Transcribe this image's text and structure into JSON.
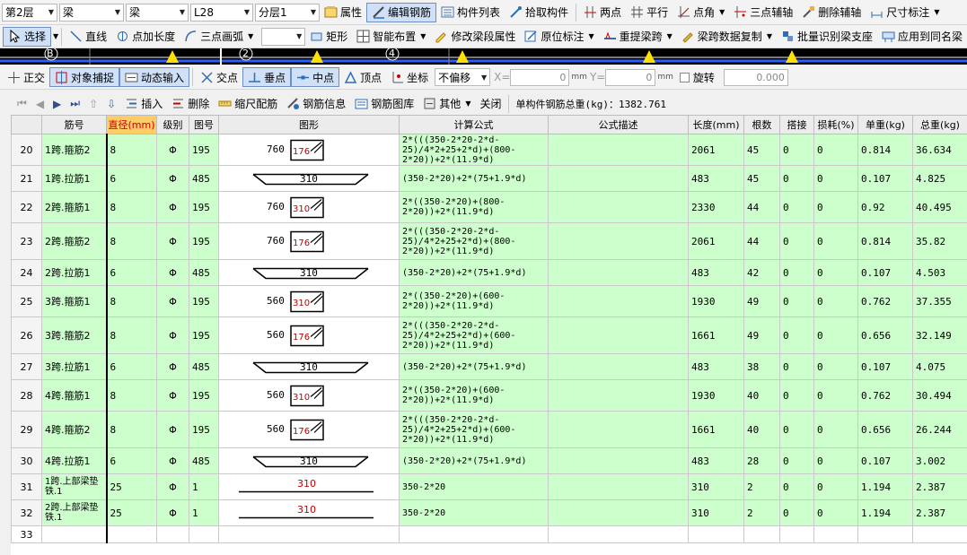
{
  "toolbar1": {
    "floor": "第2层",
    "type1": "梁",
    "type2": "梁",
    "element": "L28",
    "sublayer": "分层1",
    "attr": "属性",
    "edit_rebar": "编辑钢筋",
    "member_list": "构件列表",
    "pick_member": "拾取构件",
    "two_point": "两点",
    "parallel": "平行",
    "point_angle": "点角",
    "three_point_axis": "三点辅轴",
    "delete_axis": "删除辅轴",
    "dimension": "尺寸标注"
  },
  "toolbar2": {
    "select": "选择",
    "line": "直线",
    "point_length": "点加长度",
    "three_point_arc": "三点画弧",
    "rect": "矩形",
    "smart_layout": "智能布置",
    "modify_span": "修改梁段属性",
    "original_mark": "原位标注",
    "re_extract_span": "重提梁跨",
    "copy_span_data": "梁跨数据复制",
    "batch_support": "批量识别梁支座",
    "apply_same": "应用到同名梁"
  },
  "canvas": {
    "labels": [
      "B",
      "2",
      "4"
    ]
  },
  "toolbar3": {
    "ortho": "正交",
    "snap": "对象捕捉",
    "dynamic_input": "动态输入",
    "intersection": "交点",
    "perpendicular": "垂点",
    "midpoint": "中点",
    "vertex": "顶点",
    "coordinate": "坐标",
    "offset_mode": "不偏移",
    "x_label": "X=",
    "x_value": "0",
    "y_label": "Y=",
    "y_value": "0",
    "unit": "mm",
    "rotate_label": "旋转",
    "rotate_value": "0.000"
  },
  "toolbar4": {
    "insert": "插入",
    "delete": "删除",
    "scale_rebar": "缩尺配筋",
    "rebar_info": "钢筋信息",
    "rebar_library": "钢筋图库",
    "other": "其他",
    "close": "关闭",
    "total_label": "单构件钢筋总重(kg)：1382.761"
  },
  "table": {
    "headers": [
      "筋号",
      "直径(mm)",
      "级别",
      "图号",
      "图形",
      "计算公式",
      "公式描述",
      "长度(mm)",
      "根数",
      "搭接",
      "损耗(%)",
      "单重(kg)",
      "总重(kg)"
    ],
    "rows": [
      {
        "num": "20",
        "name": "1跨.箍筋2",
        "dia": "8",
        "grade": "Φ",
        "fig": "195",
        "shape": "stirrup",
        "s1": "760",
        "s2": "176",
        "formula": "2*(((350-2*20-2*d-25)/4*2+25+2*d)+(800-2*20))+2*(11.9*d)",
        "desc": "",
        "len": "2061",
        "count": "45",
        "lap": "0",
        "loss": "0",
        "unit_w": "0.814",
        "total_w": "36.634"
      },
      {
        "num": "21",
        "name": "1跨.拉筋1",
        "dia": "6",
        "grade": "Φ",
        "fig": "485",
        "shape": "tie",
        "s1": "310",
        "s2": "",
        "formula": "(350-2*20)+2*(75+1.9*d)",
        "desc": "",
        "len": "483",
        "count": "45",
        "lap": "0",
        "loss": "0",
        "unit_w": "0.107",
        "total_w": "4.825"
      },
      {
        "num": "22",
        "name": "2跨.箍筋1",
        "dia": "8",
        "grade": "Φ",
        "fig": "195",
        "shape": "stirrup",
        "s1": "760",
        "s2": "310",
        "formula": "2*((350-2*20)+(800-2*20))+2*(11.9*d)",
        "desc": "",
        "len": "2330",
        "count": "44",
        "lap": "0",
        "loss": "0",
        "unit_w": "0.92",
        "total_w": "40.495"
      },
      {
        "num": "23",
        "name": "2跨.箍筋2",
        "dia": "8",
        "grade": "Φ",
        "fig": "195",
        "shape": "stirrup",
        "s1": "760",
        "s2": "176",
        "formula": "2*(((350-2*20-2*d-25)/4*2+25+2*d)+(800-2*20))+2*(11.9*d)",
        "desc": "",
        "len": "2061",
        "count": "44",
        "lap": "0",
        "loss": "0",
        "unit_w": "0.814",
        "total_w": "35.82"
      },
      {
        "num": "24",
        "name": "2跨.拉筋1",
        "dia": "6",
        "grade": "Φ",
        "fig": "485",
        "shape": "tie",
        "s1": "310",
        "s2": "",
        "formula": "(350-2*20)+2*(75+1.9*d)",
        "desc": "",
        "len": "483",
        "count": "42",
        "lap": "0",
        "loss": "0",
        "unit_w": "0.107",
        "total_w": "4.503"
      },
      {
        "num": "25",
        "name": "3跨.箍筋1",
        "dia": "8",
        "grade": "Φ",
        "fig": "195",
        "shape": "stirrup",
        "s1": "560",
        "s2": "310",
        "formula": "2*((350-2*20)+(600-2*20))+2*(11.9*d)",
        "desc": "",
        "len": "1930",
        "count": "49",
        "lap": "0",
        "loss": "0",
        "unit_w": "0.762",
        "total_w": "37.355"
      },
      {
        "num": "26",
        "name": "3跨.箍筋2",
        "dia": "8",
        "grade": "Φ",
        "fig": "195",
        "shape": "stirrup",
        "s1": "560",
        "s2": "176",
        "formula": "2*(((350-2*20-2*d-25)/4*2+25+2*d)+(600-2*20))+2*(11.9*d)",
        "desc": "",
        "len": "1661",
        "count": "49",
        "lap": "0",
        "loss": "0",
        "unit_w": "0.656",
        "total_w": "32.149"
      },
      {
        "num": "27",
        "name": "3跨.拉筋1",
        "dia": "6",
        "grade": "Φ",
        "fig": "485",
        "shape": "tie",
        "s1": "310",
        "s2": "",
        "formula": "(350-2*20)+2*(75+1.9*d)",
        "desc": "",
        "len": "483",
        "count": "38",
        "lap": "0",
        "loss": "0",
        "unit_w": "0.107",
        "total_w": "4.075"
      },
      {
        "num": "28",
        "name": "4跨.箍筋1",
        "dia": "8",
        "grade": "Φ",
        "fig": "195",
        "shape": "stirrup",
        "s1": "560",
        "s2": "310",
        "formula": "2*((350-2*20)+(600-2*20))+2*(11.9*d)",
        "desc": "",
        "len": "1930",
        "count": "40",
        "lap": "0",
        "loss": "0",
        "unit_w": "0.762",
        "total_w": "30.494"
      },
      {
        "num": "29",
        "name": "4跨.箍筋2",
        "dia": "8",
        "grade": "Φ",
        "fig": "195",
        "shape": "stirrup",
        "s1": "560",
        "s2": "176",
        "formula": "2*(((350-2*20-2*d-25)/4*2+25+2*d)+(600-2*20))+2*(11.9*d)",
        "desc": "",
        "len": "1661",
        "count": "40",
        "lap": "0",
        "loss": "0",
        "unit_w": "0.656",
        "total_w": "26.244"
      },
      {
        "num": "30",
        "name": "4跨.拉筋1",
        "dia": "6",
        "grade": "Φ",
        "fig": "485",
        "shape": "tie",
        "s1": "310",
        "s2": "",
        "formula": "(350-2*20)+2*(75+1.9*d)",
        "desc": "",
        "len": "483",
        "count": "28",
        "lap": "0",
        "loss": "0",
        "unit_w": "0.107",
        "total_w": "3.002"
      },
      {
        "num": "31",
        "name": "1跨.上部梁垫铁.1",
        "dia": "25",
        "grade": "Φ",
        "fig": "1",
        "shape": "bar",
        "s1": "310",
        "s2": "",
        "formula": "350-2*20",
        "desc": "",
        "len": "310",
        "count": "2",
        "lap": "0",
        "loss": "0",
        "unit_w": "1.194",
        "total_w": "2.387"
      },
      {
        "num": "32",
        "name": "2跨.上部梁垫铁.1",
        "dia": "25",
        "grade": "Φ",
        "fig": "1",
        "shape": "bar",
        "s1": "310",
        "s2": "",
        "formula": "350-2*20",
        "desc": "",
        "len": "310",
        "count": "2",
        "lap": "0",
        "loss": "0",
        "unit_w": "1.194",
        "total_w": "2.387"
      }
    ],
    "empty_row_num": "33"
  },
  "colors": {
    "row_bg": "#ccffcc",
    "header_highlight": "#ffcc66",
    "accent_red": "#c00000"
  }
}
